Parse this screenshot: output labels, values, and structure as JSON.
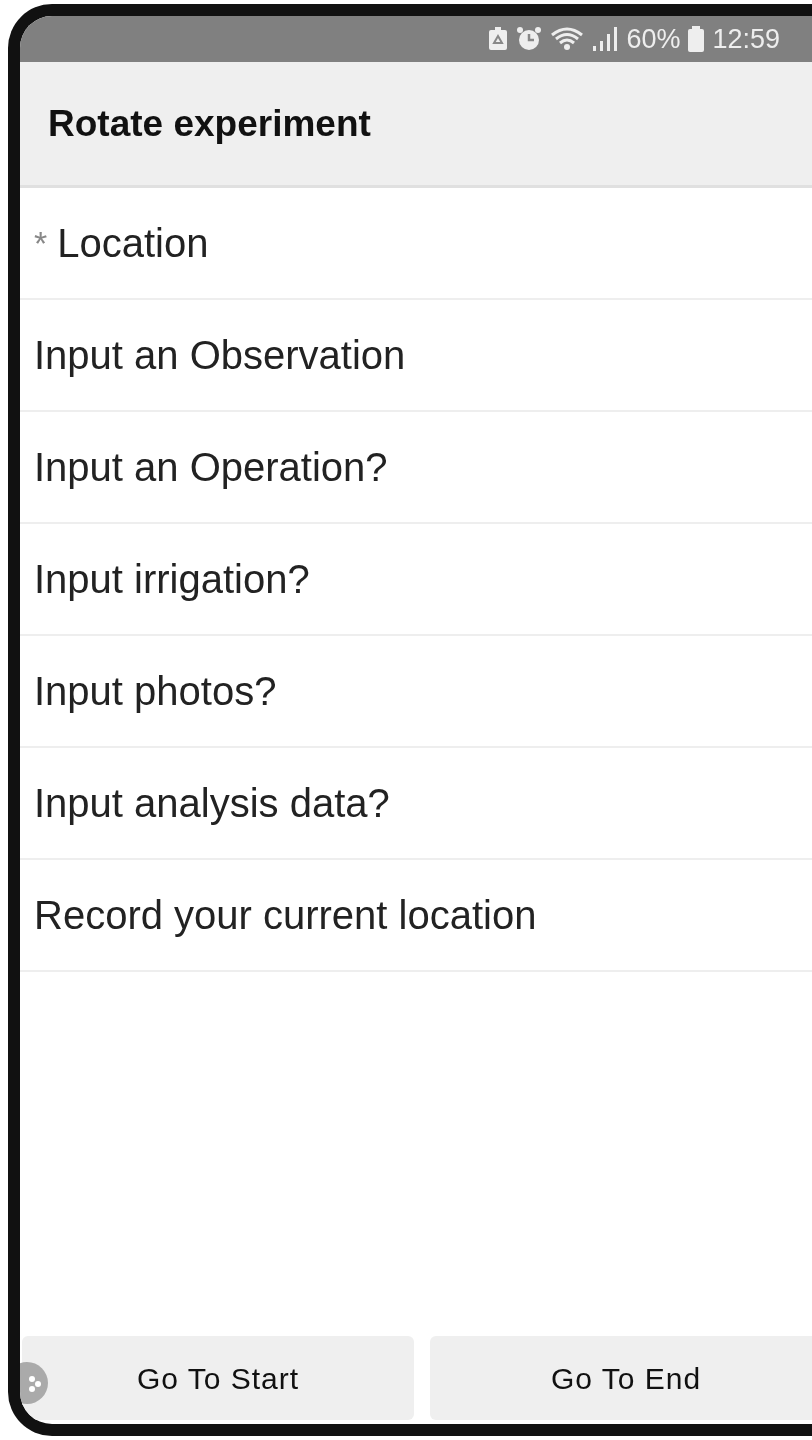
{
  "status_bar": {
    "battery": "60%",
    "time": "12:59"
  },
  "title": "Rotate experiment",
  "items": [
    {
      "label": "Location",
      "required": true
    },
    {
      "label": "Input an Observation",
      "required": false
    },
    {
      "label": "Input an Operation?",
      "required": false
    },
    {
      "label": "Input irrigation?",
      "required": false
    },
    {
      "label": "Input photos?",
      "required": false
    },
    {
      "label": "Input analysis data?",
      "required": false
    },
    {
      "label": "Record your current location",
      "required": false
    }
  ],
  "required_mark": "*",
  "buttons": [
    "Go To Start",
    "Go To End"
  ]
}
